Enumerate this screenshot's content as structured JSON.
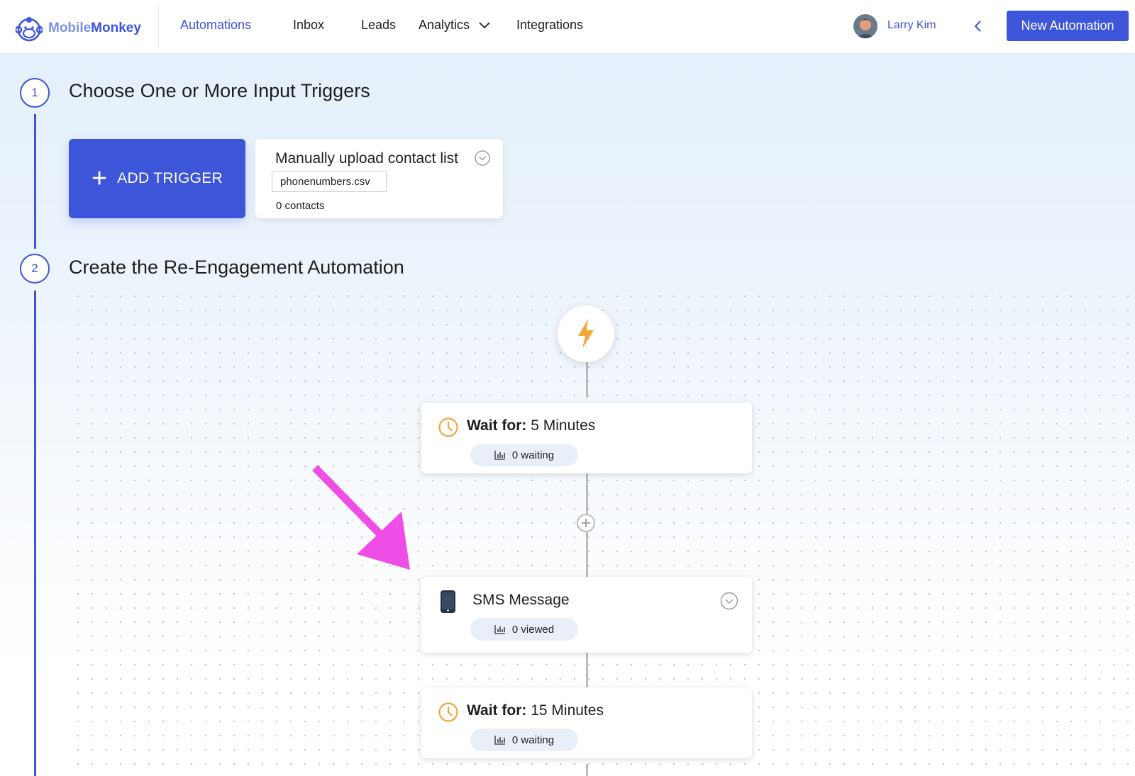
{
  "brand": {
    "logo_part1": "Mobile",
    "logo_part2": "Monkey"
  },
  "nav": {
    "automations": "Automations",
    "inbox": "Inbox",
    "leads": "Leads",
    "analytics": "Analytics",
    "integrations": "Integrations"
  },
  "user": {
    "name": "Larry Kim"
  },
  "header": {
    "new_automation": "New Automation"
  },
  "step1": {
    "number": "1",
    "title": "Choose One or More Input Triggers",
    "add_trigger": "ADD TRIGGER",
    "trigger_card": {
      "title": "Manually upload contact list",
      "file": "phonenumbers.csv",
      "contacts": "0 contacts"
    }
  },
  "step2": {
    "number": "2",
    "title": "Create the Re-Engagement Automation"
  },
  "nodes": [
    {
      "label": "Wait for:",
      "value": "5 Minutes",
      "stat": "0 waiting"
    },
    {
      "label": "SMS Message",
      "stat": "0 viewed"
    },
    {
      "label": "Wait for:",
      "value": "15 Minutes",
      "stat": "0 waiting"
    }
  ],
  "colors": {
    "accent": "#3d55d9",
    "bolt": "#f2a93b",
    "clock": "#f0a73d",
    "annotation_arrow": "#ee4ee6"
  },
  "icons": {
    "logo": "monkey-icon",
    "trigger": "lightning-bolt-icon",
    "wait": "clock-icon",
    "sms": "phone-icon",
    "stats": "bar-chart-icon"
  }
}
